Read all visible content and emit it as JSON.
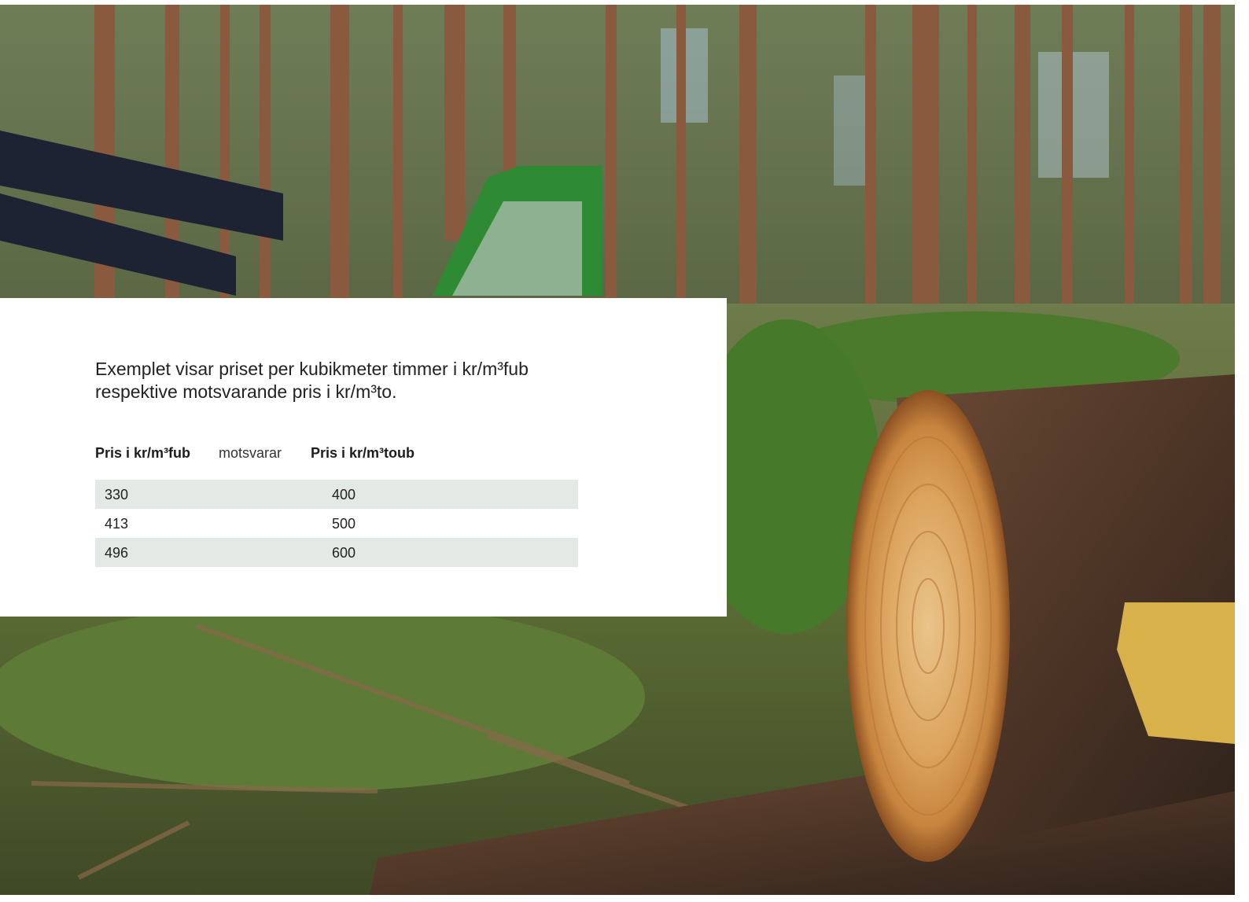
{
  "photo": {
    "description_icon": "forest-harvest-photo"
  },
  "card": {
    "intro": "Exemplet visar priset per kubikmeter timmer i kr/m³fub respektive motsvarande pris i kr/m³to.",
    "table": {
      "headers": {
        "fub": "Pris i kr/m³fub",
        "middle": "motsvarar",
        "toub": "Pris i kr/m³toub"
      },
      "rows": [
        {
          "fub": "330",
          "toub": "400"
        },
        {
          "fub": "413",
          "toub": "500"
        },
        {
          "fub": "496",
          "toub": "600"
        }
      ],
      "stripe_color": "#e3e9e4"
    }
  }
}
